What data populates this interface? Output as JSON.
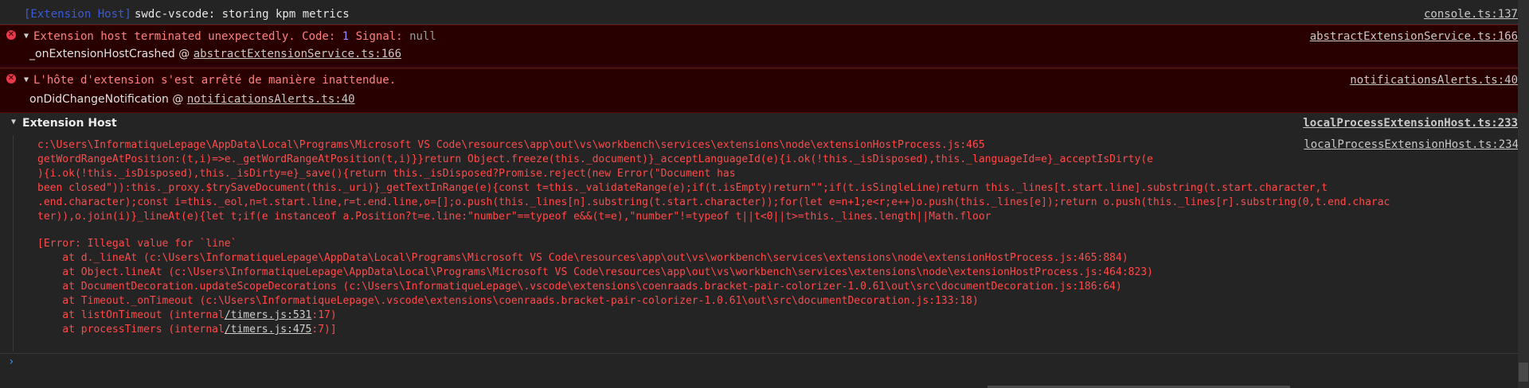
{
  "messages": {
    "log": {
      "context": "[Extension Host]",
      "text": "swdc-vscode: storing kpm metrics",
      "source": "console.ts:137"
    },
    "crash": {
      "text_prefix": "Extension host terminated unexpectedly. Code:",
      "code_value": "1",
      "signal_label": "Signal:",
      "signal_value": "null",
      "source": "abstractExtensionService.ts:166",
      "trace_fn": "_onExtensionHostCrashed @",
      "trace_link": "abstractExtensionService.ts:166"
    },
    "notify": {
      "text": "L'hôte d'extension s'est arrêté de manière inattendue.",
      "source": "notificationsAlerts.ts:40",
      "trace_fn": "onDidChangeNotification @",
      "trace_link": "notificationsAlerts.ts:40"
    }
  },
  "group": {
    "title": "Extension Host",
    "source": "localProcessExtensionHost.ts:233",
    "inner_source": "localProcessExtensionHost.ts:234",
    "code_lines": [
      "c:\\Users\\InformatiqueLepage\\AppData\\Local\\Programs\\Microsoft VS Code\\resources\\app\\out\\vs\\workbench\\services\\extensions\\node\\extensionHostProcess.js:465",
      "getWordRangeAtPosition:(t,i)=>e._getWordRangeAtPosition(t,i)}}return Object.freeze(this._document)}_acceptLanguageId(e){i.ok(!this._isDisposed),this._languageId=e}_acceptIsDirty(e",
      "){i.ok(!this._isDisposed),this._isDirty=e}_save(){return this._isDisposed?Promise.reject(new Error(\"Document has",
      "been closed\")):this._proxy.$trySaveDocument(this._uri)}_getTextInRange(e){const t=this._validateRange(e);if(t.isEmpty)return\"\";if(t.isSingleLine)return this._lines[t.start.line].substring(t.start.character,t",
      ".end.character);const i=this._eol,n=t.start.line,r=t.end.line,o=[];o.push(this._lines[n].substring(t.start.character));for(let e=n+1;e<r;e++)o.push(this._lines[e]);return o.push(this._lines[r].substring(0,t.end.charac",
      "ter)),o.join(i)}_lineAt(e){let t;if(e instanceof a.Position?t=e.line:\"number\"==typeof e&&(t=e),\"number\"!=typeof t||t<0||t>=this._lines.length||Math.floor"
    ],
    "error_header": "[Error: Illegal value for `line`",
    "stack": [
      "    at d._lineAt (c:\\Users\\InformatiqueLepage\\AppData\\Local\\Programs\\Microsoft VS Code\\resources\\app\\out\\vs\\workbench\\services\\extensions\\node\\extensionHostProcess.js:465:884)",
      "    at Object.lineAt (c:\\Users\\InformatiqueLepage\\AppData\\Local\\Programs\\Microsoft VS Code\\resources\\app\\out\\vs\\workbench\\services\\extensions\\node\\extensionHostProcess.js:464:823)",
      "    at DocumentDecoration.updateScopeDecorations (c:\\Users\\InformatiqueLepage\\.vscode\\extensions\\coenraads.bracket-pair-colorizer-1.0.61\\out\\src\\documentDecoration.js:186:64)",
      "    at Timeout._onTimeout (c:\\Users\\InformatiqueLepage\\.vscode\\extensions\\coenraads.bracket-pair-colorizer-1.0.61\\out\\src\\documentDecoration.js:133:18)"
    ],
    "timer1": {
      "prefix": "    at listOnTimeout (internal",
      "link": "/timers.js:531",
      "suffix": ":17)"
    },
    "timer2": {
      "prefix": "    at processTimers (internal",
      "link": "/timers.js:475",
      "suffix": ":7)]"
    }
  },
  "prompt": {
    "symbol": "›"
  },
  "colors": {
    "error_bg": "#290000",
    "error_text": "#ff4a4a",
    "link": "#c8c8c8",
    "prompt": "#3794ff"
  }
}
